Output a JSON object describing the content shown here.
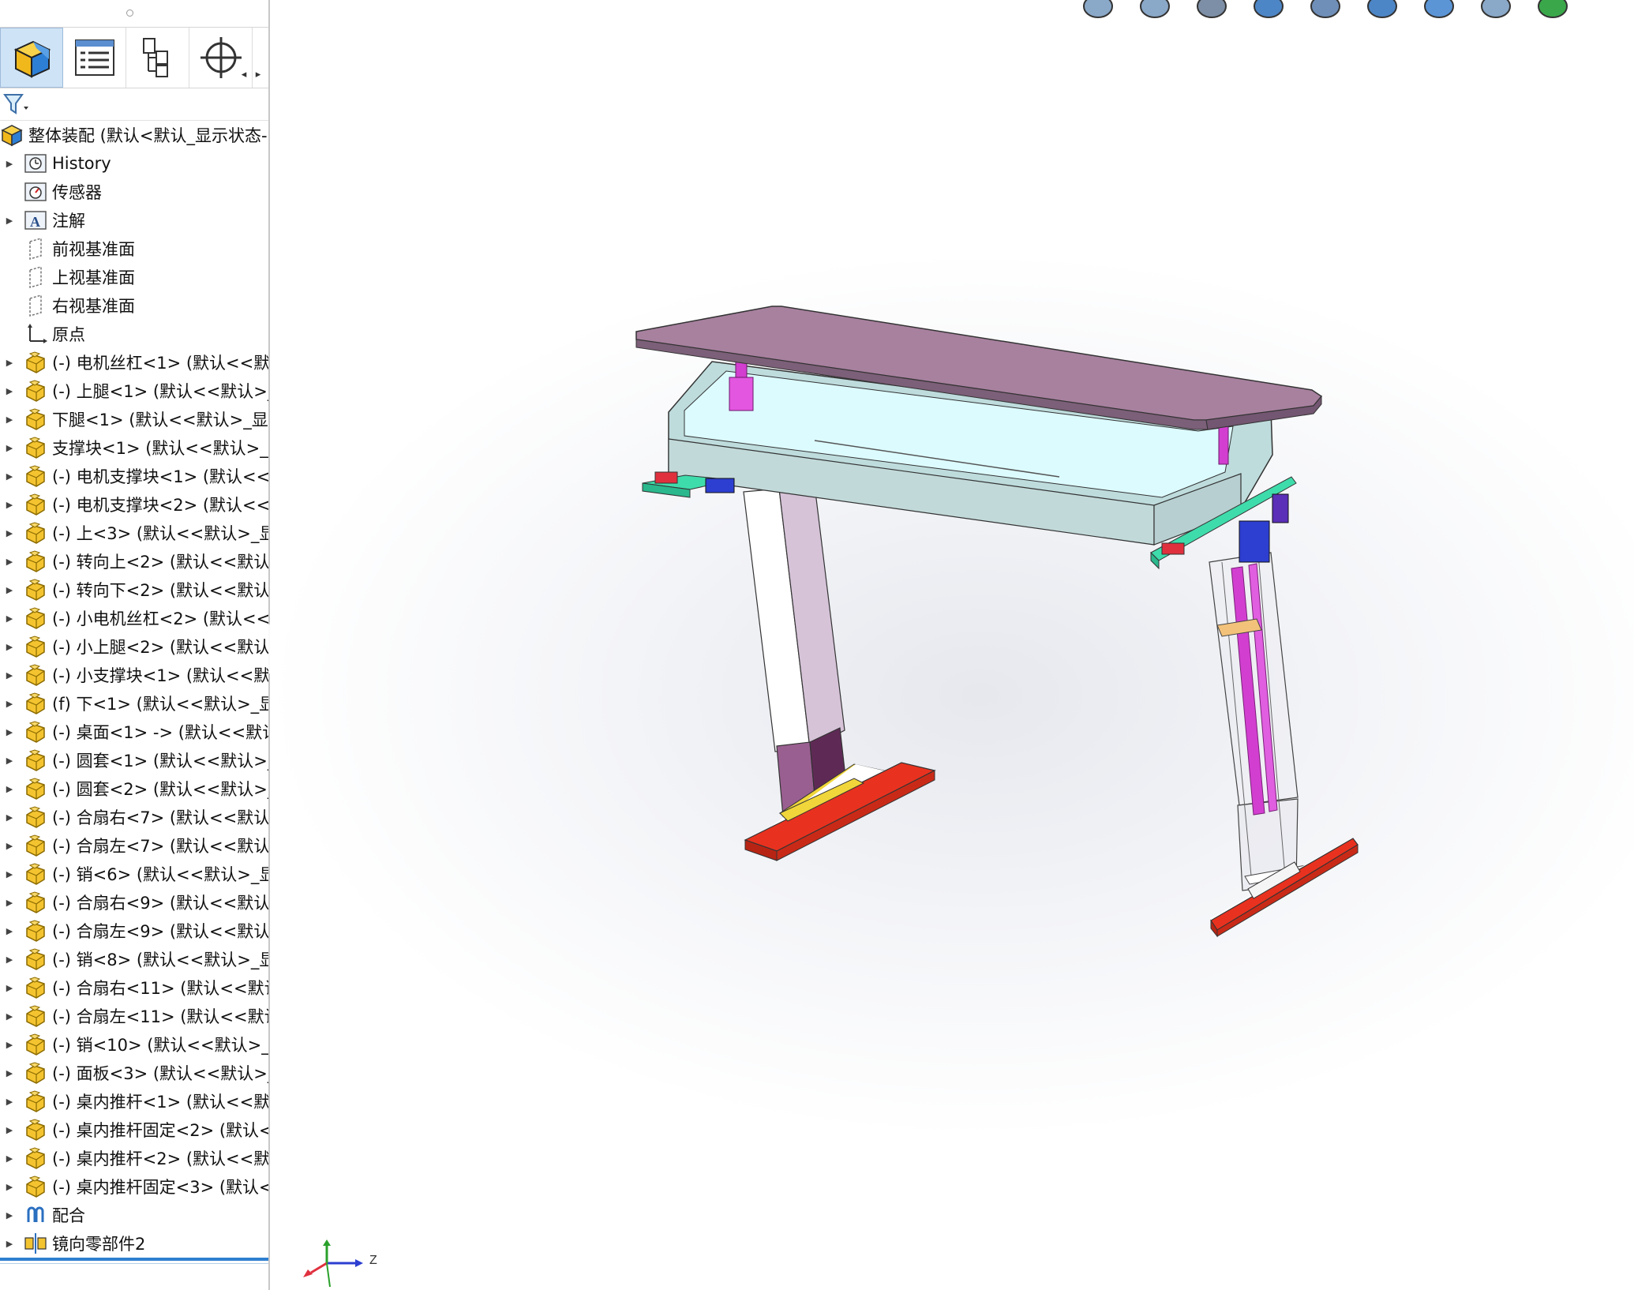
{
  "panel": {
    "tabs": [
      {
        "name": "feature-manager-tab",
        "icon": "part-cube-icon"
      },
      {
        "name": "property-manager-tab",
        "icon": "property-list-icon"
      },
      {
        "name": "configuration-manager-tab",
        "icon": "configuration-icon"
      },
      {
        "name": "dimxpert-tab",
        "icon": "crosshair-icon"
      }
    ]
  },
  "tree": {
    "root": "整体装配  (默认<默认_显示状态-",
    "items": [
      {
        "label": "History",
        "icon": "history-folder-icon",
        "expand": true
      },
      {
        "label": "传感器",
        "icon": "sensor-folder-icon",
        "expand": false
      },
      {
        "label": "注解",
        "icon": "annotation-folder-icon",
        "expand": true
      },
      {
        "label": "前视基准面",
        "icon": "plane-icon",
        "expand": false
      },
      {
        "label": "上视基准面",
        "icon": "plane-icon",
        "expand": false
      },
      {
        "label": "右视基准面",
        "icon": "plane-icon",
        "expand": false
      },
      {
        "label": "原点",
        "icon": "origin-icon",
        "expand": false
      },
      {
        "label": "(-) 电机丝杠<1> (默认<<默认",
        "icon": "part-icon",
        "expand": true
      },
      {
        "label": "(-) 上腿<1> (默认<<默认>_显",
        "icon": "part-icon",
        "expand": true
      },
      {
        "label": "下腿<1> (默认<<默认>_显示",
        "icon": "part-icon",
        "expand": true
      },
      {
        "label": "支撑块<1> (默认<<默认>_显",
        "icon": "part-icon",
        "expand": true
      },
      {
        "label": "(-) 电机支撑块<1> (默认<<默",
        "icon": "part-icon",
        "expand": true
      },
      {
        "label": "(-) 电机支撑块<2> (默认<<默",
        "icon": "part-icon",
        "expand": true
      },
      {
        "label": "(-) 上<3> (默认<<默认>_显示",
        "icon": "part-icon",
        "expand": true
      },
      {
        "label": "(-) 转向上<2> (默认<<默认>",
        "icon": "part-icon",
        "expand": true
      },
      {
        "label": "(-) 转向下<2> (默认<<默认>",
        "icon": "part-icon",
        "expand": true
      },
      {
        "label": "(-) 小电机丝杠<2> (默认<<默",
        "icon": "part-icon",
        "expand": true
      },
      {
        "label": "(-) 小上腿<2> (默认<<默认>",
        "icon": "part-icon",
        "expand": true
      },
      {
        "label": "(-) 小支撑块<1> (默认<<默认",
        "icon": "part-icon",
        "expand": true
      },
      {
        "label": "(f) 下<1> (默认<<默认>_显示",
        "icon": "part-icon",
        "expand": true
      },
      {
        "label": "(-) 桌面<1> -> (默认<<默认",
        "icon": "part-icon",
        "expand": true
      },
      {
        "label": "(-) 圆套<1> (默认<<默认>_显",
        "icon": "part-icon",
        "expand": true
      },
      {
        "label": "(-) 圆套<2> (默认<<默认>_显",
        "icon": "part-icon",
        "expand": true
      },
      {
        "label": "(-) 合扇右<7> (默认<<默认>",
        "icon": "part-icon",
        "expand": true
      },
      {
        "label": "(-) 合扇左<7> (默认<<默认>",
        "icon": "part-icon",
        "expand": true
      },
      {
        "label": "(-) 销<6> (默认<<默认>_显示",
        "icon": "part-icon",
        "expand": true
      },
      {
        "label": "(-) 合扇右<9> (默认<<默认>",
        "icon": "part-icon",
        "expand": true
      },
      {
        "label": "(-) 合扇左<9> (默认<<默认>",
        "icon": "part-icon",
        "expand": true
      },
      {
        "label": "(-) 销<8> (默认<<默认>_显示",
        "icon": "part-icon",
        "expand": true
      },
      {
        "label": "(-) 合扇右<11> (默认<<默认",
        "icon": "part-icon",
        "expand": true
      },
      {
        "label": "(-) 合扇左<11> (默认<<默认",
        "icon": "part-icon",
        "expand": true
      },
      {
        "label": "(-) 销<10> (默认<<默认>_显",
        "icon": "part-icon",
        "expand": true
      },
      {
        "label": "(-) 面板<3> (默认<<默认>_显",
        "icon": "part-icon",
        "expand": true
      },
      {
        "label": "(-) 桌内推杆<1> (默认<<默认",
        "icon": "part-icon",
        "expand": true
      },
      {
        "label": "(-) 桌内推杆固定<2> (默认<<",
        "icon": "part-icon",
        "expand": true
      },
      {
        "label": "(-) 桌内推杆<2> (默认<<默认",
        "icon": "part-icon",
        "expand": true
      },
      {
        "label": "(-) 桌内推杆固定<3> (默认<<",
        "icon": "part-icon",
        "expand": true
      },
      {
        "label": "配合",
        "icon": "mates-icon",
        "expand": true
      },
      {
        "label": "镜向零部件2",
        "icon": "mirror-component-icon",
        "expand": true
      }
    ]
  },
  "triad": {
    "z_label": "Z"
  },
  "colors": {
    "tabletop": "#a8819f",
    "frame": "#c5dfe0",
    "frame_inner": "#dcfaff",
    "foot": "#e8321f",
    "bracket": "#3fdcab",
    "actuator": "#d23fd0",
    "motor": "#2d3fd0",
    "leg_upper": "#d3c0d6",
    "leg_lower": "#7a3d71"
  },
  "viewport_toolbar": [
    "zoom-to-fit-icon",
    "zoom-area-icon",
    "previous-view-icon",
    "section-view-icon",
    "dynamic-annotation-icon",
    "view-orientation-icon",
    "display-style-icon",
    "hide-show-icon",
    "edit-appearance-icon"
  ]
}
